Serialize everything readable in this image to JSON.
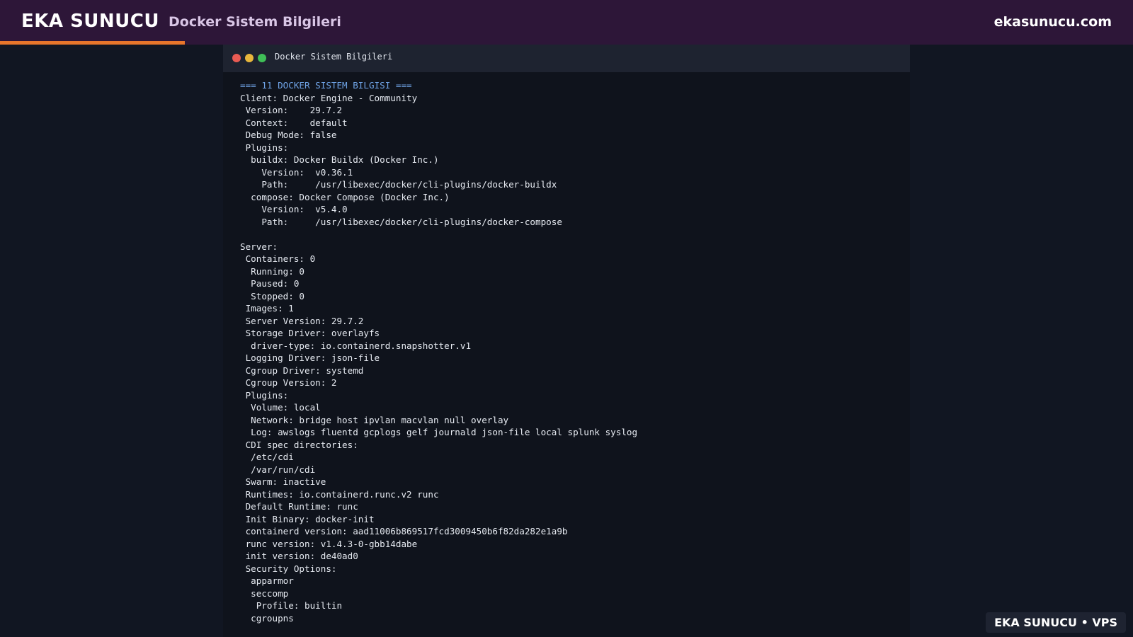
{
  "header": {
    "brand": "EKA SUNUCU",
    "subtitle": "Docker Sistem Bilgileri",
    "site": "ekasunucu.com",
    "accent_color": "#e8762b",
    "background_color": "#2d1638"
  },
  "terminal": {
    "title": "Docker Sistem Bilgileri",
    "heading": "=== 11 DOCKER SISTEM BILGISI ===",
    "lines": [
      "Client: Docker Engine - Community",
      " Version:    29.7.2",
      " Context:    default",
      " Debug Mode: false",
      " Plugins:",
      "  buildx: Docker Buildx (Docker Inc.)",
      "    Version:  v0.36.1",
      "    Path:     /usr/libexec/docker/cli-plugins/docker-buildx",
      "  compose: Docker Compose (Docker Inc.)",
      "    Version:  v5.4.0",
      "    Path:     /usr/libexec/docker/cli-plugins/docker-compose",
      "",
      "Server:",
      " Containers: 0",
      "  Running: 0",
      "  Paused: 0",
      "  Stopped: 0",
      " Images: 1",
      " Server Version: 29.7.2",
      " Storage Driver: overlayfs",
      "  driver-type: io.containerd.snapshotter.v1",
      " Logging Driver: json-file",
      " Cgroup Driver: systemd",
      " Cgroup Version: 2",
      " Plugins:",
      "  Volume: local",
      "  Network: bridge host ipvlan macvlan null overlay",
      "  Log: awslogs fluentd gcplogs gelf journald json-file local splunk syslog",
      " CDI spec directories:",
      "  /etc/cdi",
      "  /var/run/cdi",
      " Swarm: inactive",
      " Runtimes: io.containerd.runc.v2 runc",
      " Default Runtime: runc",
      " Init Binary: docker-init",
      " containerd version: aad11006b869517fcd3009450b6f82da282e1a9b",
      " runc version: v1.4.3-0-gbb14dabe",
      " init version: de40ad0",
      " Security Options:",
      "  apparmor",
      "  seccomp",
      "   Profile: builtin",
      "  cgroupns"
    ]
  },
  "footer": {
    "badge": "EKA SUNUCU • VPS"
  }
}
